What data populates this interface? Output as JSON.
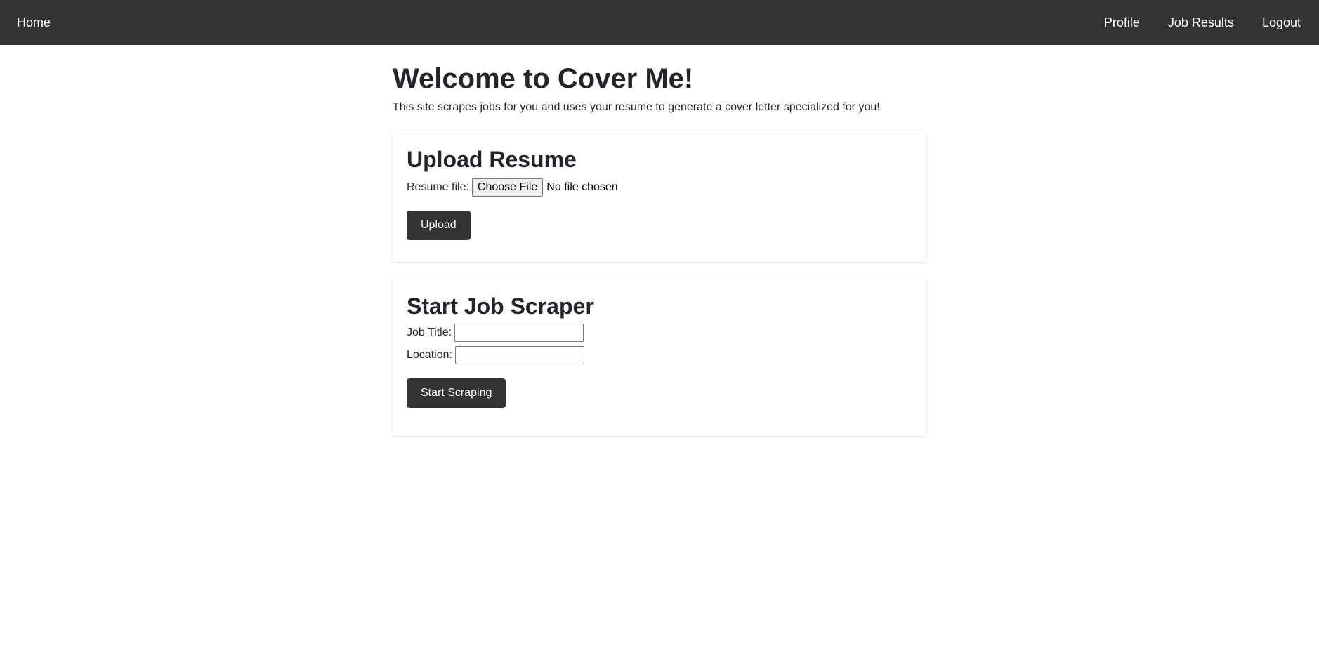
{
  "nav": {
    "home_label": "Home",
    "right_items": [
      "Profile",
      "Job Results",
      "Logout"
    ]
  },
  "main": {
    "title": "Welcome to Cover Me!",
    "intro": "This site scrapes jobs for you and uses your resume to generate a cover letter specialized for you!"
  },
  "upload_card": {
    "heading": "Upload Resume",
    "file_label": "Resume file:",
    "file_button": "Choose File",
    "file_status": "No file chosen",
    "submit_label": "Upload"
  },
  "scraper_card": {
    "heading": "Start Job Scraper",
    "job_title_label": "Job Title:",
    "job_title_value": "",
    "location_label": "Location:",
    "location_value": "",
    "submit_label": "Start Scraping"
  },
  "colors": {
    "navbar": "#333333",
    "button": "#333333"
  }
}
